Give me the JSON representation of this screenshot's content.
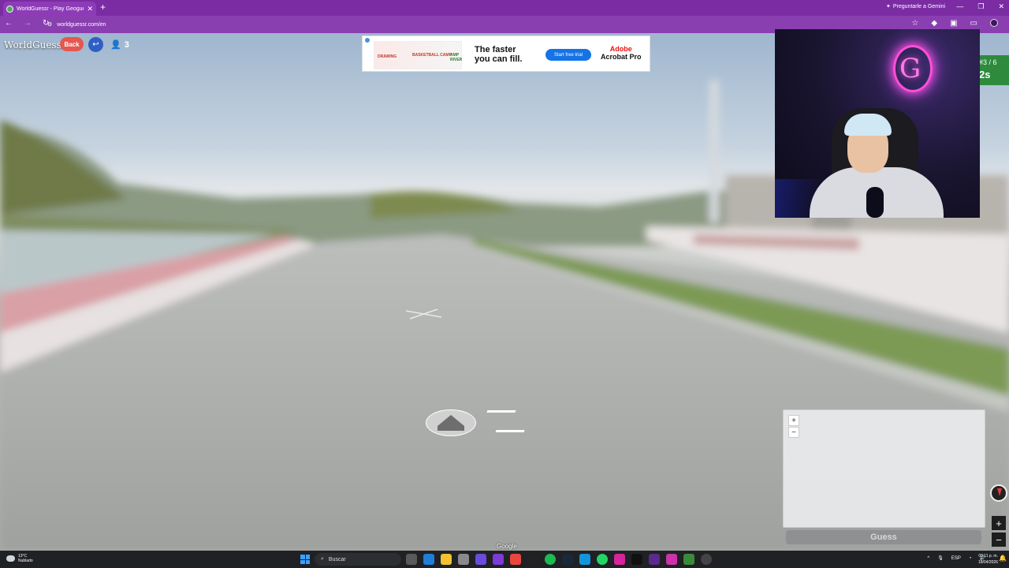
{
  "browser": {
    "tab_title": "WorldGuessr - Play Geoguessr Free",
    "url": "worldguessr.com/en",
    "gemini_label": "Preguntarle a Gemini"
  },
  "game": {
    "logo": "WorldGuessr",
    "back_label": "Back",
    "player_count": "3",
    "round": "#3 / 6",
    "timer": "2s",
    "guess_label": "Guess",
    "attribution": "Google",
    "map_zoom_in": "+",
    "map_zoom_out": "−",
    "sv_zoom_in": "+",
    "sv_zoom_out": "−"
  },
  "ad": {
    "thumb_text_1": "DRAWING",
    "thumb_text_2": "BASKETBALL CAMP",
    "thumb_text_3": "AMP RIVER",
    "headline": "The faster you can fill.",
    "cta": "Start free trial",
    "brand_line1": "Adobe",
    "brand_line2": "Acrobat Pro"
  },
  "webcam": {
    "neon_letter": "G"
  },
  "taskbar": {
    "temperature": "13°C",
    "weather": "Nublado",
    "search_placeholder": "Buscar",
    "language": "ESP",
    "time": "08:11 p. m.",
    "date": "18/04/2026"
  },
  "colors": {
    "browser_purple": "#7b2ca3",
    "back_red": "#e5574f",
    "round_green": "#2e8b3e"
  }
}
